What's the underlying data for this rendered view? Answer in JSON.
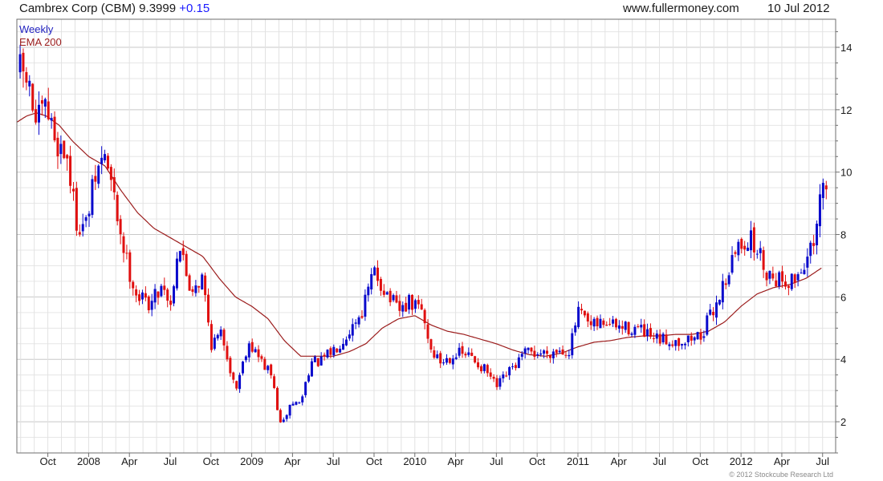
{
  "header": {
    "title": "Cambrex Corp (CBM) 9.3999",
    "change": "+0.15",
    "site": "www.fullermoney.com",
    "date": "10 Jul 2012"
  },
  "credit": "© 2012 Stockcube Research Ltd",
  "colors": {
    "up": "#0a0acc",
    "down": "#e01010",
    "ema": "#9b1c1c",
    "grid": "#d6d6d6",
    "frame": "#6e6e6e"
  },
  "chart_data": {
    "type": "candlestick",
    "legend": [
      {
        "label": "Weekly",
        "color": "#1f1fbf"
      },
      {
        "label": "EMA 200",
        "color": "#9b1c1c"
      }
    ],
    "legend_position": "top-left",
    "grid": true,
    "x_ticks": [
      {
        "label": "Oct",
        "t": 2007.75
      },
      {
        "label": "2008",
        "t": 2008.0
      },
      {
        "label": "Apr",
        "t": 2008.25
      },
      {
        "label": "Jul",
        "t": 2008.5
      },
      {
        "label": "Oct",
        "t": 2008.75
      },
      {
        "label": "2009",
        "t": 2009.0
      },
      {
        "label": "Apr",
        "t": 2009.25
      },
      {
        "label": "Jul",
        "t": 2009.5
      },
      {
        "label": "Oct",
        "t": 2009.75
      },
      {
        "label": "2010",
        "t": 2010.0
      },
      {
        "label": "Apr",
        "t": 2010.25
      },
      {
        "label": "Jul",
        "t": 2010.5
      },
      {
        "label": "Oct",
        "t": 2010.75
      },
      {
        "label": "2011",
        "t": 2011.0
      },
      {
        "label": "Apr",
        "t": 2011.25
      },
      {
        "label": "Jul",
        "t": 2011.5
      },
      {
        "label": "Oct",
        "t": 2011.75
      },
      {
        "label": "2012",
        "t": 2012.0
      },
      {
        "label": "Apr",
        "t": 2012.25
      },
      {
        "label": "Jul",
        "t": 2012.5
      }
    ],
    "xlim": [
      2007.56,
      2012.58
    ],
    "y_ticks": [
      2,
      4,
      6,
      8,
      10,
      12,
      14
    ],
    "ylim": [
      1.0,
      14.9
    ],
    "y_axis_side": "right",
    "price_anchors": [
      [
        2007.58,
        13.2
      ],
      [
        2007.62,
        13.0
      ],
      [
        2007.68,
        11.5
      ],
      [
        2007.74,
        12.0
      ],
      [
        2007.8,
        11.0
      ],
      [
        2007.87,
        10.5
      ],
      [
        2007.92,
        8.5
      ],
      [
        2007.98,
        8.2
      ],
      [
        2008.04,
        9.8
      ],
      [
        2008.1,
        10.6
      ],
      [
        2008.16,
        9.0
      ],
      [
        2008.23,
        7.2
      ],
      [
        2008.3,
        6.0
      ],
      [
        2008.38,
        5.8
      ],
      [
        2008.46,
        6.5
      ],
      [
        2008.5,
        5.6
      ],
      [
        2008.55,
        7.8
      ],
      [
        2008.62,
        6.3
      ],
      [
        2008.7,
        6.6
      ],
      [
        2008.75,
        4.5
      ],
      [
        2008.82,
        4.8
      ],
      [
        2008.9,
        3.0
      ],
      [
        2008.98,
        4.6
      ],
      [
        2009.05,
        4.0
      ],
      [
        2009.12,
        3.5
      ],
      [
        2009.18,
        1.8
      ],
      [
        2009.24,
        2.6
      ],
      [
        2009.3,
        2.6
      ],
      [
        2009.36,
        3.9
      ],
      [
        2009.42,
        3.9
      ],
      [
        2009.5,
        4.3
      ],
      [
        2009.58,
        4.8
      ],
      [
        2009.68,
        5.6
      ],
      [
        2009.75,
        6.8
      ],
      [
        2009.82,
        6.2
      ],
      [
        2009.9,
        5.5
      ],
      [
        2009.96,
        5.8
      ],
      [
        2010.04,
        5.6
      ],
      [
        2010.1,
        4.3
      ],
      [
        2010.16,
        3.9
      ],
      [
        2010.25,
        4.2
      ],
      [
        2010.34,
        4.1
      ],
      [
        2010.44,
        3.6
      ],
      [
        2010.5,
        3.1
      ],
      [
        2010.58,
        3.6
      ],
      [
        2010.68,
        4.2
      ],
      [
        2010.78,
        4.2
      ],
      [
        2010.88,
        4.3
      ],
      [
        2010.95,
        4.3
      ],
      [
        2011.0,
        5.5
      ],
      [
        2011.08,
        5.0
      ],
      [
        2011.16,
        5.2
      ],
      [
        2011.26,
        5.0
      ],
      [
        2011.36,
        5.0
      ],
      [
        2011.46,
        4.6
      ],
      [
        2011.56,
        4.6
      ],
      [
        2011.66,
        4.6
      ],
      [
        2011.76,
        4.8
      ],
      [
        2011.84,
        5.7
      ],
      [
        2011.92,
        6.8
      ],
      [
        2011.98,
        7.6
      ],
      [
        2012.04,
        7.9
      ],
      [
        2012.1,
        7.5
      ],
      [
        2012.16,
        6.8
      ],
      [
        2012.24,
        6.6
      ],
      [
        2012.32,
        6.5
      ],
      [
        2012.4,
        7.2
      ],
      [
        2012.46,
        7.7
      ],
      [
        2012.49,
        9.5
      ],
      [
        2012.52,
        9.4
      ]
    ],
    "ema_anchors": [
      [
        2007.56,
        11.6
      ],
      [
        2007.62,
        11.8
      ],
      [
        2007.68,
        11.9
      ],
      [
        2007.74,
        11.8
      ],
      [
        2007.82,
        11.5
      ],
      [
        2007.9,
        11.0
      ],
      [
        2008.0,
        10.5
      ],
      [
        2008.1,
        10.2
      ],
      [
        2008.2,
        9.4
      ],
      [
        2008.3,
        8.7
      ],
      [
        2008.4,
        8.2
      ],
      [
        2008.5,
        7.9
      ],
      [
        2008.6,
        7.6
      ],
      [
        2008.7,
        7.3
      ],
      [
        2008.8,
        6.6
      ],
      [
        2008.9,
        6.0
      ],
      [
        2009.0,
        5.7
      ],
      [
        2009.1,
        5.3
      ],
      [
        2009.2,
        4.6
      ],
      [
        2009.3,
        4.1
      ],
      [
        2009.4,
        4.1
      ],
      [
        2009.5,
        4.1
      ],
      [
        2009.6,
        4.25
      ],
      [
        2009.7,
        4.5
      ],
      [
        2009.8,
        5.0
      ],
      [
        2009.9,
        5.3
      ],
      [
        2010.0,
        5.4
      ],
      [
        2010.1,
        5.1
      ],
      [
        2010.2,
        4.9
      ],
      [
        2010.3,
        4.8
      ],
      [
        2010.4,
        4.65
      ],
      [
        2010.5,
        4.5
      ],
      [
        2010.6,
        4.3
      ],
      [
        2010.7,
        4.15
      ],
      [
        2010.8,
        4.1
      ],
      [
        2010.9,
        4.2
      ],
      [
        2011.0,
        4.4
      ],
      [
        2011.1,
        4.55
      ],
      [
        2011.2,
        4.6
      ],
      [
        2011.3,
        4.7
      ],
      [
        2011.4,
        4.75
      ],
      [
        2011.5,
        4.75
      ],
      [
        2011.6,
        4.8
      ],
      [
        2011.7,
        4.8
      ],
      [
        2011.8,
        4.9
      ],
      [
        2011.9,
        5.2
      ],
      [
        2012.0,
        5.7
      ],
      [
        2012.1,
        6.1
      ],
      [
        2012.2,
        6.3
      ],
      [
        2012.3,
        6.4
      ],
      [
        2012.4,
        6.6
      ],
      [
        2012.5,
        6.95
      ]
    ]
  }
}
